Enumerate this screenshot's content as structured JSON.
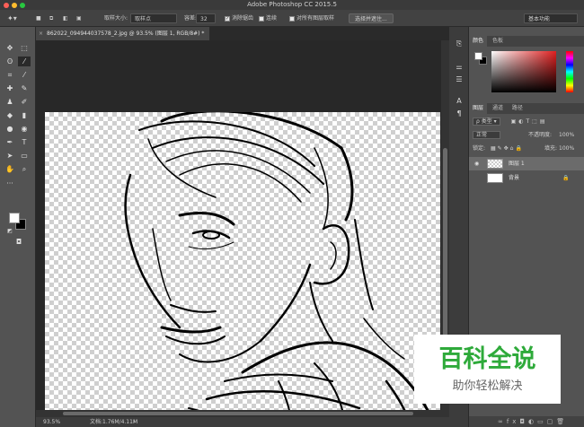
{
  "app": {
    "title": "Adobe Photoshop CC 2015.5"
  },
  "options": {
    "sample_size_label": "取样大小:",
    "sample_size_value": "取样点",
    "tolerance_label": "容差:",
    "tolerance_value": "32",
    "antialias_label": "消除锯齿",
    "contiguous_label": "连续",
    "sample_all_label": "对所有图层取样",
    "select_mask_button": "选择并遮住...",
    "workspace_value": "基本功能"
  },
  "document": {
    "tab_label": "862022_094944037578_2.jpg @ 93.5% (图层 1, RGB/8#) *"
  },
  "status": {
    "zoom": "93.5%",
    "doc_size": "文档:1.76M/4.11M"
  },
  "panels": {
    "color_tabs": [
      "颜色",
      "色板"
    ],
    "layers_tabs": [
      "图层",
      "通道",
      "路径"
    ],
    "filter_kind": "类型",
    "blend_mode": "正常",
    "opacity_label": "不透明度:",
    "opacity_value": "100%",
    "lock_label": "锁定:",
    "fill_label": "填充:",
    "fill_value": "100%",
    "layers": [
      {
        "name": "图层 1"
      },
      {
        "name": "背景"
      }
    ]
  },
  "watermark": {
    "title": "百科全说",
    "subtitle": "助你轻松解决"
  },
  "colors": {
    "accent_green": "#2eaa3a",
    "foreground": "#ffffff",
    "background": "#000000"
  }
}
